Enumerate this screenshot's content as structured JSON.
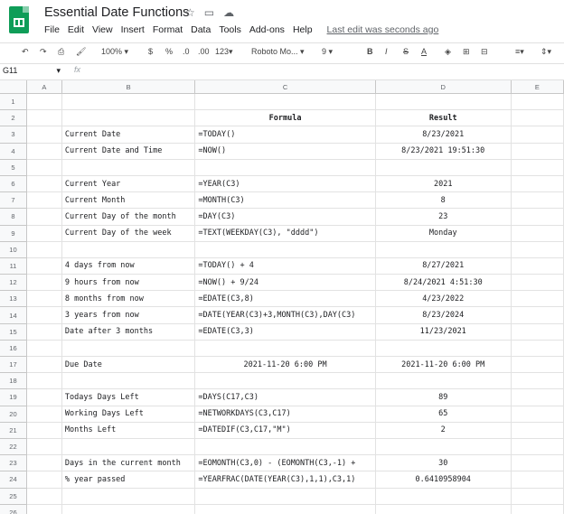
{
  "app": {
    "title": "Essential Date Functions",
    "title_icons": [
      "star-icon",
      "folder-move-icon",
      "cloud-status-icon"
    ],
    "menus": [
      "File",
      "Edit",
      "View",
      "Insert",
      "Format",
      "Data",
      "Tools",
      "Add-ons",
      "Help"
    ],
    "last_edit": "Last edit was seconds ago"
  },
  "toolbar": {
    "zoom": "100%",
    "currency": "$",
    "percent": "%",
    "dec_less": ".0",
    "dec_more": ".00",
    "more_formats": "123",
    "font": "Roboto Mo...",
    "font_size": "9",
    "bold": "B",
    "italic": "I",
    "strike": "S",
    "text_color": "A"
  },
  "formula_bar": {
    "name_box": "G11",
    "fx": "fx",
    "value": ""
  },
  "columns": [
    "A",
    "B",
    "C",
    "D",
    "E"
  ],
  "rows": [
    {
      "n": "1",
      "b": "",
      "c": "",
      "d": ""
    },
    {
      "n": "2",
      "b": "",
      "c": "Formula",
      "d": "Result"
    },
    {
      "n": "3",
      "b": "Current Date",
      "c": "=TODAY()",
      "d": "8/23/2021"
    },
    {
      "n": "4",
      "b": "Current Date and Time",
      "c": "=NOW()",
      "d": "8/23/2021 19:51:30"
    },
    {
      "n": "5",
      "b": "",
      "c": "",
      "d": ""
    },
    {
      "n": "6",
      "b": "Current Year",
      "c": "=YEAR(C3)",
      "d": "2021"
    },
    {
      "n": "7",
      "b": "Current Month",
      "c": "=MONTH(C3)",
      "d": "8"
    },
    {
      "n": "8",
      "b": "Current Day of the month",
      "c": "=DAY(C3)",
      "d": "23"
    },
    {
      "n": "9",
      "b": "Current Day of the week",
      "c": "=TEXT(WEEKDAY(C3), \"dddd\")",
      "d": "Monday"
    },
    {
      "n": "10",
      "b": "",
      "c": "",
      "d": ""
    },
    {
      "n": "11",
      "b": "4 days from now",
      "c": "=TODAY() + 4",
      "d": "8/27/2021"
    },
    {
      "n": "12",
      "b": "9 hours from now",
      "c": "=NOW() + 9/24",
      "d": "8/24/2021 4:51:30"
    },
    {
      "n": "13",
      "b": "8 months from now",
      "c": "=EDATE(C3,8)",
      "d": "4/23/2022"
    },
    {
      "n": "14",
      "b": "3 years from now",
      "c": "=DATE(YEAR(C3)+3,MONTH(C3),DAY(C3)",
      "d": "8/23/2024"
    },
    {
      "n": "15",
      "b": "Date after 3 months",
      "c": "=EDATE(C3,3)",
      "d": "11/23/2021"
    },
    {
      "n": "16",
      "b": "",
      "c": "",
      "d": ""
    },
    {
      "n": "17",
      "b": "Due Date",
      "c": "2021-11-20 6:00 PM",
      "d": "2021-11-20 6:00 PM"
    },
    {
      "n": "18",
      "b": "",
      "c": "",
      "d": ""
    },
    {
      "n": "19",
      "b": "Todays Days Left",
      "c": "=DAYS(C17,C3)",
      "d": "89"
    },
    {
      "n": "20",
      "b": "Working Days Left",
      "c": "=NETWORKDAYS(C3,C17)",
      "d": "65"
    },
    {
      "n": "21",
      "b": "Months Left",
      "c": "=DATEDIF(C3,C17,\"M\")",
      "d": "2"
    },
    {
      "n": "22",
      "b": "",
      "c": "",
      "d": ""
    },
    {
      "n": "23",
      "b": "Days in the current month",
      "c": "=EOMONTH(C3,0) - (EOMONTH(C3,-1) +",
      "d": "30"
    },
    {
      "n": "24",
      "b": "% year passed",
      "c": "=YEARFRAC(DATE(YEAR(C3),1,1),C3,1)",
      "d": "0.6410958904"
    },
    {
      "n": "25",
      "b": "",
      "c": "",
      "d": ""
    },
    {
      "n": "26",
      "b": "",
      "c": "",
      "d": ""
    }
  ]
}
